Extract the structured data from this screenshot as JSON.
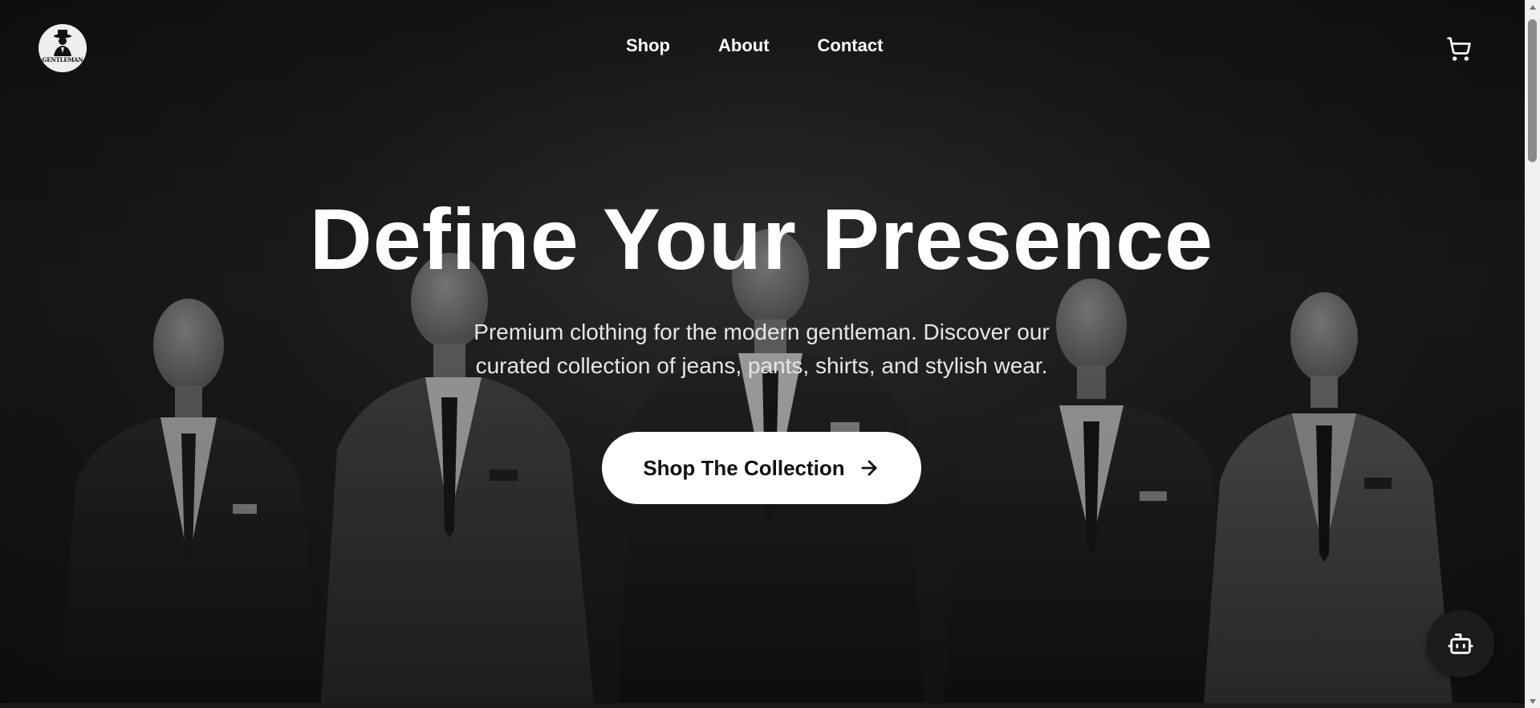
{
  "header": {
    "logo_text": "GENTLEMAN",
    "nav": [
      "Shop",
      "About",
      "Contact"
    ],
    "cart_icon": "cart-icon"
  },
  "hero": {
    "title": "Define Your Presence",
    "subtitle_line1": "Premium clothing for the modern gentleman. Discover our",
    "subtitle_line2": "curated collection of jeans, pants, shirts, and stylish wear.",
    "cta_label": "Shop The Collection",
    "cta_icon": "arrow-right-icon"
  },
  "widgets": {
    "chatbot_icon": "robot-icon"
  },
  "colors": {
    "text": "#ffffff",
    "button_bg": "#ffffff",
    "button_text": "#111111",
    "background": "#1a1a1a"
  }
}
